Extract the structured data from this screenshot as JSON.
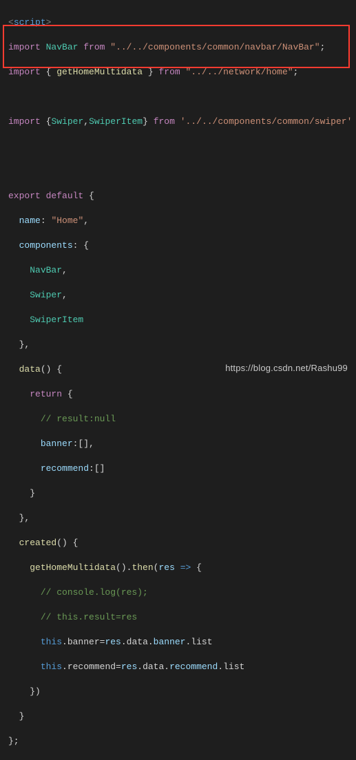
{
  "line1_open": "<",
  "line1_tag": "script",
  "line1_close": ">",
  "imp": "import",
  "frm": "from",
  "navbar": "NavBar",
  "navbar_path": "\"../../components/common/navbar/NavBar\"",
  "ghm": "getHomeMultidata",
  "ghm_path": "\"../../network/home\"",
  "swiper": "Swiper",
  "swiperitem": "SwiperItem",
  "swiper_path": "'../../components/common/swiper'",
  "export": "export",
  "default": "default",
  "name_k": "name",
  "name_v": "\"Home\"",
  "components_k": "components",
  "data_k": "data",
  "return": "return",
  "c_result": "// result:null",
  "banner_k": "banner",
  "recommend_k": "recommend",
  "created_k": "created",
  "then": "then",
  "res": "res",
  "arrow": "=>",
  "c_log": "// console.log(res);",
  "c_this": "// this.result=res",
  "this": "this",
  "banner_eq": ".banner=",
  "recommend_eq": ".recommend=",
  "resdata": ".data.",
  "banner_w": "banner",
  "recommend_w": "recommend",
  "list": ".list",
  "watermark": "https://blog.csdn.net/Rashu99"
}
